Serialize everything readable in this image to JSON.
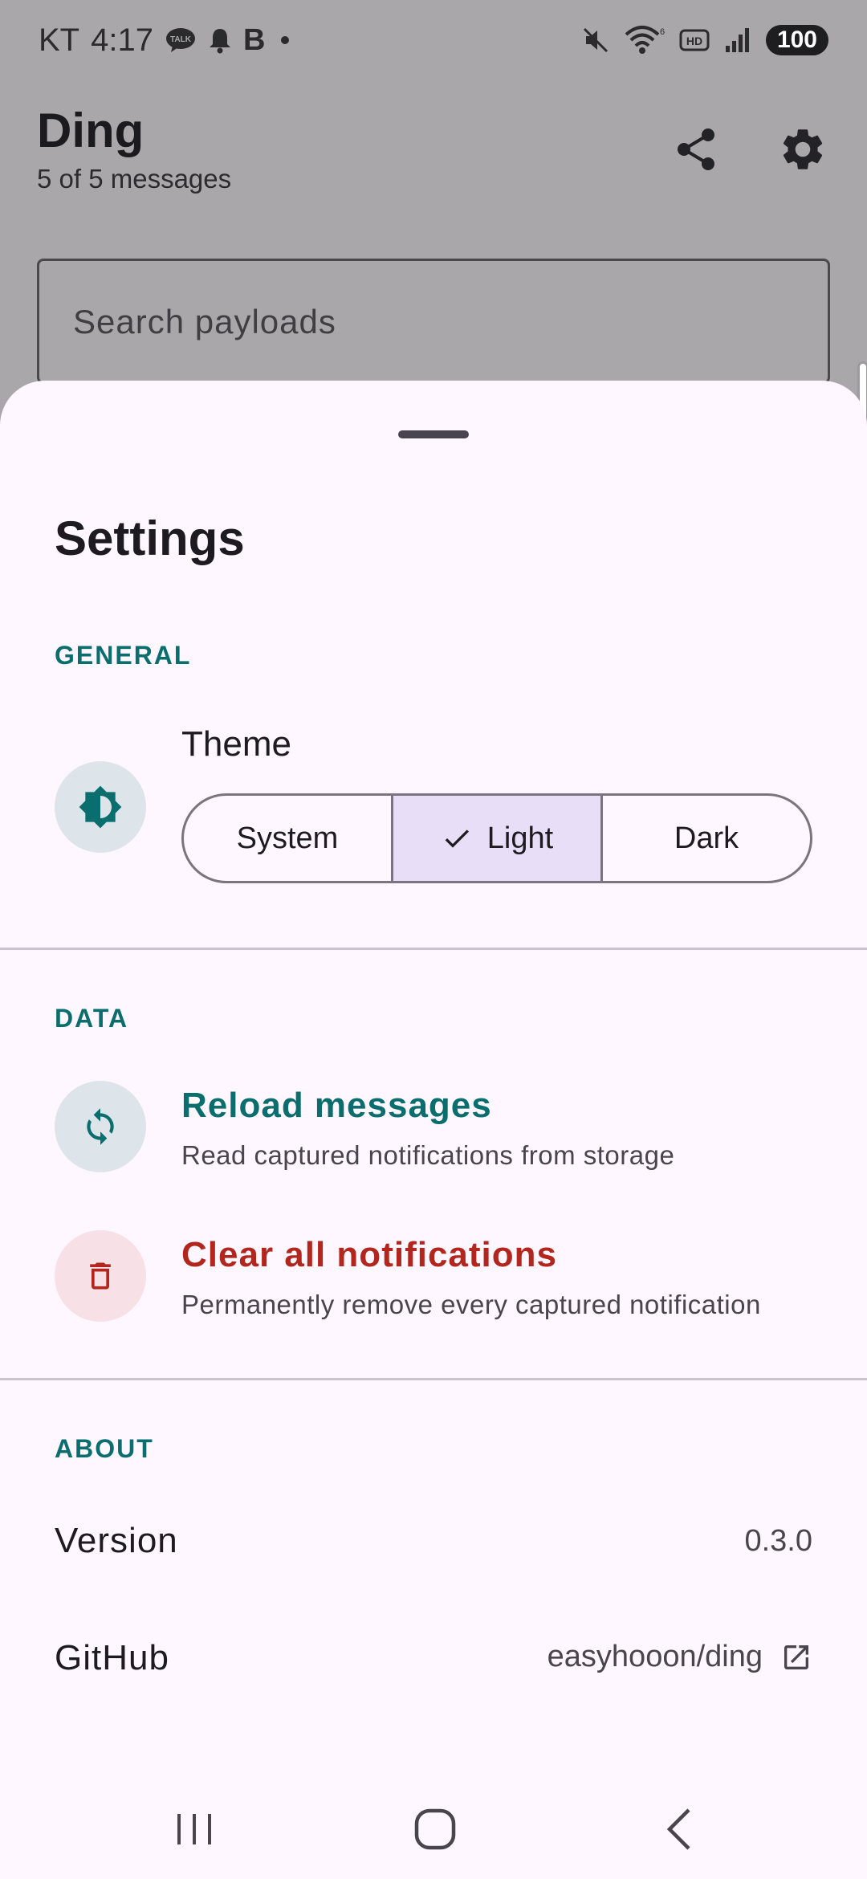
{
  "status_bar": {
    "carrier": "KT",
    "time": "4:17",
    "notification_icons": [
      "talk-icon",
      "bell-icon",
      "b-icon",
      "dot-icon"
    ],
    "system_icons": [
      "mute-icon",
      "wifi-icon",
      "hd-icon",
      "signal-icon"
    ],
    "battery": "100"
  },
  "app_bar": {
    "title": "Ding",
    "subtitle": "5 of 5 messages",
    "actions": [
      "share-icon",
      "gear-icon"
    ]
  },
  "search": {
    "placeholder": "Search payloads"
  },
  "settings": {
    "title": "Settings",
    "general": {
      "label": "GENERAL",
      "theme": {
        "label": "Theme",
        "options": [
          "System",
          "Light",
          "Dark"
        ],
        "selected": "Light"
      }
    },
    "data": {
      "label": "DATA",
      "reload": {
        "title": "Reload messages",
        "subtitle": "Read captured notifications from storage"
      },
      "clear": {
        "title": "Clear all notifications",
        "subtitle": "Permanently remove every captured notification"
      }
    },
    "about": {
      "label": "ABOUT",
      "version_label": "Version",
      "version_value": "0.3.0",
      "github_label": "GitHub",
      "github_value": "easyhooon/ding"
    }
  },
  "colors": {
    "accent": "#0b6e6e",
    "danger": "#b3261e",
    "sheet_bg": "#fef7ff",
    "selected_segment": "#e8def8",
    "scrim": "#aaa7ab"
  }
}
